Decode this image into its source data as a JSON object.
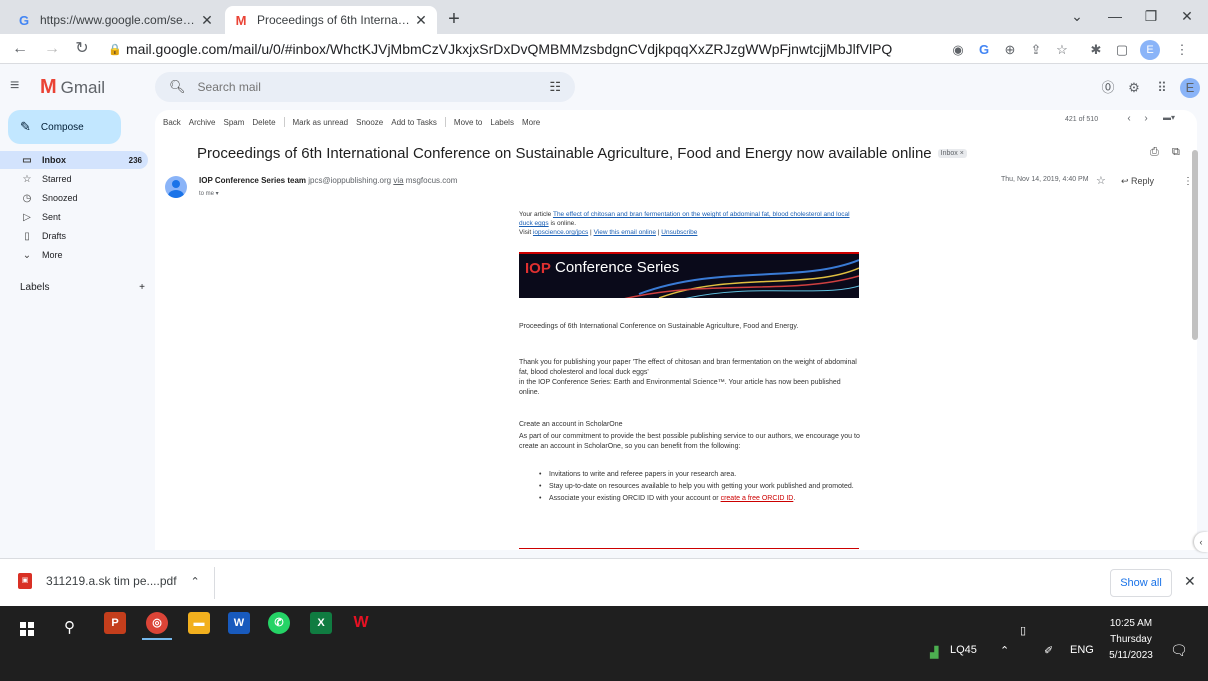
{
  "browser": {
    "tabs": [
      {
        "title": "https://www.google.com/search?",
        "favicon": "G"
      },
      {
        "title": "Proceedings of 6th International",
        "favicon": "M"
      }
    ],
    "url": "mail.google.com/mail/u/0/#inbox/WhctKJVjMbmCzVJkxjxSrDxDvQMBMMzsbdgnCVdjkpqqXxZRJzgWWpFjnwtcjjMbJlfVlPQ",
    "profile_initial": "E"
  },
  "gmail": {
    "logo_text": "Gmail",
    "search_placeholder": "Search mail",
    "profile_initial": "E",
    "compose_label": "Compose",
    "nav": [
      {
        "icon": "inbox-icon",
        "label": "Inbox",
        "count": "236"
      },
      {
        "icon": "star-icon",
        "label": "Starred",
        "count": ""
      },
      {
        "icon": "clock-icon",
        "label": "Snoozed",
        "count": ""
      },
      {
        "icon": "send-icon",
        "label": "Sent",
        "count": ""
      },
      {
        "icon": "draft-icon",
        "label": "Drafts",
        "count": ""
      },
      {
        "icon": "chevron-down-icon",
        "label": "More",
        "count": ""
      }
    ],
    "labels_title": "Labels",
    "actions": [
      "Back",
      "Archive",
      "Spam",
      "Delete",
      "Mark as unread",
      "Snooze",
      "Add to Tasks",
      "Move to",
      "Labels",
      "More"
    ],
    "pager": "421 of 510"
  },
  "email": {
    "subject": "Proceedings of 6th International Conference on Sustainable Agriculture, Food and Energy now available online",
    "label_chip": "Inbox ×",
    "sender_name": "IOP Conference Series team",
    "sender_email": "jpcs@ioppublishing.org",
    "via": "via",
    "via_domain": "msgfocus.com",
    "to": "to me ▾",
    "date": "Thu, Nov 14, 2019, 4:40 PM",
    "reply_label": "Reply",
    "body": {
      "intro_prefix": "Your article ",
      "article_link": "The effect of chitosan and bran fermentation on the weight of abdominal fat, blood cholesterol and local duck eggs",
      "intro_suffix": " is online.",
      "visit_prefix": "Visit ",
      "visit_link": "iopscience.org/jpcs",
      "visit_sep1": " | ",
      "view_online": "View this email online",
      "visit_sep2": " | ",
      "unsubscribe": "Unsubscribe",
      "banner_iop": "IOP",
      "banner_text": "Conference Series",
      "heading": "Proceedings of 6th International Conference on Sustainable Agriculture, Food and Energy.",
      "thanks_prefix": "Thank you for publishing your paper '",
      "thanks_link": "The effect of chitosan and bran fermentation on the weight of abdominal fat, blood cholesterol and local duck eggs",
      "thanks_suffix": "'",
      "published_text": "in the IOP Conference Series: Earth and Environmental Science™. Your article has now been published online.",
      "scholar_heading": "Create an account in ScholarOne",
      "scholar_prefix": "As part of our commitment to provide the best possible publishing service to our authors, we encourage you to ",
      "scholar_link": "create an account in ScholarOne",
      "scholar_suffix": ", so you can benefit from the following:",
      "bullet1": "Invitations to write and referee papers in your research area.",
      "bullet2": "Stay up-to-date on resources available to help you with getting your work published and promoted.",
      "bullet3_prefix": "Associate your existing ORCID ID with your account or ",
      "bullet3_link": "create a free ORCID ID",
      "bullet3_suffix": "."
    }
  },
  "download_bar": {
    "file": "311219.a.sk tim pe....pdf",
    "show_all": "Show all"
  },
  "taskbar": {
    "weather": "LQ45",
    "lang": "ENG",
    "time": "10:25 AM",
    "day": "Thursday",
    "date": "5/11/2023"
  }
}
